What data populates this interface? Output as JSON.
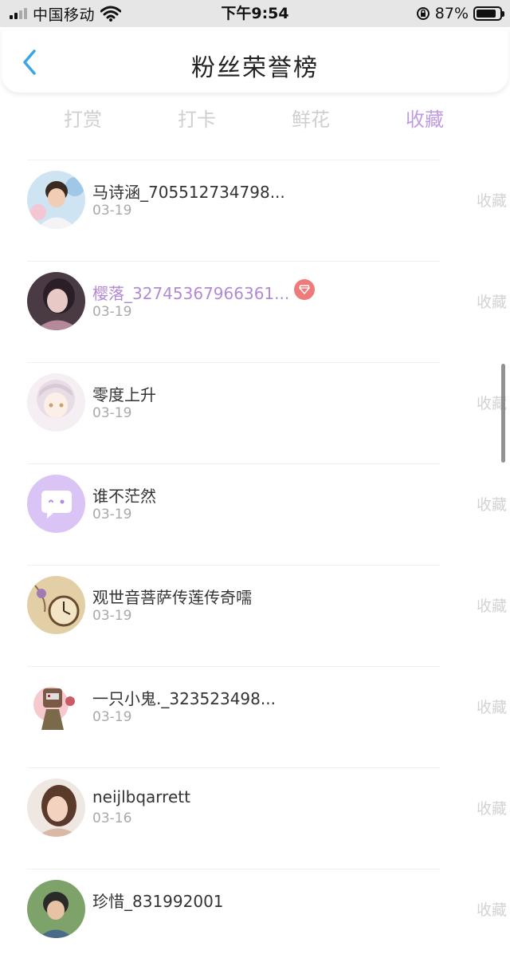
{
  "status_bar": {
    "carrier": "中国移动",
    "time": "下午9:54",
    "battery_percent": "87%",
    "battery_level": 0.87
  },
  "header": {
    "title": "粉丝荣誉榜",
    "back_icon": "chevron-left-icon",
    "accent_color": "#39a6e8"
  },
  "tabs": [
    {
      "label": "打赏",
      "active": false
    },
    {
      "label": "打卡",
      "active": false
    },
    {
      "label": "鲜花",
      "active": false
    },
    {
      "label": "收藏",
      "active": true
    }
  ],
  "colors": {
    "active_tab": "#bf9be6",
    "vip_name": "#b18ad6",
    "vip_badge": "#ef7a7a",
    "muted_text": "#a9a9a9"
  },
  "fans": [
    {
      "name": "马诗涵_705512734798...",
      "date": "03-19",
      "action": "收藏",
      "vip": false,
      "avatar": "girl-photo-avatar"
    },
    {
      "name": "樱落_32745367966361...",
      "date": "03-19",
      "action": "收藏",
      "vip": true,
      "avatar": "girl-photo-avatar"
    },
    {
      "name": "零度上升",
      "date": "03-19",
      "action": "收藏",
      "vip": false,
      "avatar": "anime-girl-avatar"
    },
    {
      "name": "谁不茫然",
      "date": "03-19",
      "action": "收藏",
      "vip": false,
      "avatar": "default-chat-avatar"
    },
    {
      "name": "观世音菩萨传莲传奇嚅",
      "date": "03-19",
      "action": "收藏",
      "vip": false,
      "avatar": "pocket-watch-avatar"
    },
    {
      "name": "一只小鬼._323523498...",
      "date": "03-19",
      "action": "收藏",
      "vip": false,
      "avatar": "cartoon-character-avatar"
    },
    {
      "name": "neijlbqarrett",
      "date": "03-16",
      "action": "收藏",
      "vip": false,
      "avatar": "woman-photo-avatar"
    },
    {
      "name": "珍惜_831992001",
      "date": "",
      "action": "收藏",
      "vip": false,
      "avatar": "child-photo-avatar"
    }
  ]
}
